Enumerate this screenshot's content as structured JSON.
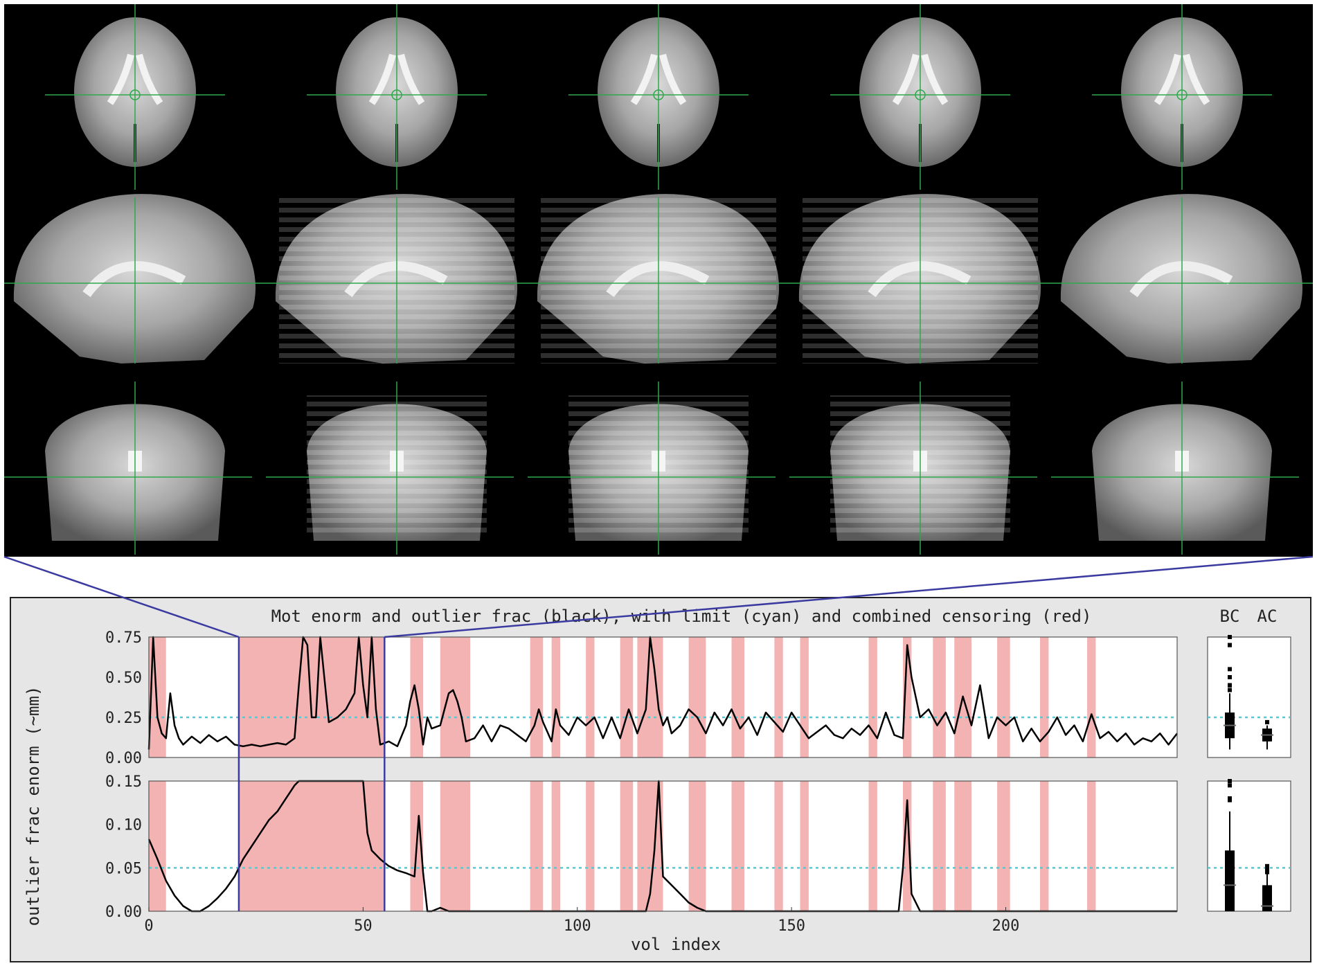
{
  "brain": {
    "columns": 5,
    "rows": [
      "axial",
      "sagittal",
      "coronal"
    ],
    "colors": {
      "background": "#000000",
      "crosshair": "#2ea84a"
    }
  },
  "plot": {
    "title": "Mot enorm and outlier frac (black), with limit (cyan) and combined censoring (red)",
    "ylabel": "outlier frac   enorm (~mm)",
    "xlabel": "vol index",
    "boxplot_labels": {
      "bc": "BC",
      "ac": "AC"
    },
    "colors": {
      "line": "#000000",
      "limit": "#5bc8d0",
      "censor": "#f4b3b3",
      "zoom": "#3a3aa0",
      "panel_bg": "#e6e6e6"
    }
  },
  "chart_data": [
    {
      "type": "line",
      "name": "enorm",
      "ylim": [
        0,
        0.75
      ],
      "yticks": [
        "0.75",
        "0.50",
        "0.25",
        "0.00"
      ],
      "xlim": [
        0,
        240
      ],
      "limit": 0.25,
      "x": [
        0,
        1,
        2,
        3,
        4,
        5,
        6,
        7,
        8,
        10,
        12,
        14,
        16,
        18,
        20,
        22,
        24,
        26,
        28,
        30,
        32,
        34,
        35,
        36,
        37,
        38,
        39,
        40,
        42,
        44,
        46,
        48,
        49,
        50,
        51,
        52,
        53,
        54,
        56,
        58,
        60,
        61,
        62,
        63,
        64,
        65,
        66,
        68,
        70,
        71,
        72,
        73,
        74,
        76,
        78,
        80,
        82,
        84,
        86,
        88,
        90,
        91,
        92,
        94,
        95,
        96,
        98,
        100,
        102,
        104,
        106,
        108,
        110,
        112,
        114,
        116,
        117,
        118,
        119,
        120,
        121,
        122,
        124,
        126,
        128,
        130,
        132,
        134,
        136,
        138,
        140,
        142,
        144,
        146,
        148,
        150,
        152,
        154,
        156,
        158,
        160,
        162,
        164,
        166,
        168,
        170,
        172,
        174,
        176,
        177,
        178,
        180,
        182,
        184,
        186,
        188,
        190,
        192,
        194,
        196,
        198,
        200,
        202,
        204,
        206,
        208,
        210,
        212,
        214,
        216,
        218,
        220,
        222,
        224,
        226,
        228,
        230,
        232,
        234,
        236,
        238,
        240
      ],
      "y": [
        0.05,
        0.75,
        0.25,
        0.15,
        0.12,
        0.4,
        0.2,
        0.12,
        0.08,
        0.13,
        0.09,
        0.14,
        0.1,
        0.13,
        0.08,
        0.07,
        0.08,
        0.07,
        0.08,
        0.09,
        0.08,
        0.12,
        0.45,
        0.8,
        0.7,
        0.25,
        0.25,
        0.8,
        0.22,
        0.25,
        0.3,
        0.4,
        0.8,
        0.45,
        0.25,
        0.8,
        0.3,
        0.08,
        0.1,
        0.07,
        0.2,
        0.35,
        0.45,
        0.3,
        0.08,
        0.25,
        0.18,
        0.2,
        0.4,
        0.42,
        0.35,
        0.25,
        0.1,
        0.12,
        0.2,
        0.1,
        0.2,
        0.18,
        0.14,
        0.1,
        0.2,
        0.3,
        0.22,
        0.1,
        0.3,
        0.2,
        0.14,
        0.25,
        0.2,
        0.25,
        0.12,
        0.25,
        0.12,
        0.3,
        0.15,
        0.3,
        0.8,
        0.55,
        0.3,
        0.2,
        0.25,
        0.15,
        0.2,
        0.3,
        0.25,
        0.15,
        0.28,
        0.2,
        0.3,
        0.18,
        0.25,
        0.14,
        0.28,
        0.22,
        0.16,
        0.28,
        0.2,
        0.12,
        0.16,
        0.2,
        0.14,
        0.12,
        0.18,
        0.14,
        0.2,
        0.12,
        0.28,
        0.14,
        0.12,
        0.7,
        0.5,
        0.25,
        0.3,
        0.2,
        0.28,
        0.15,
        0.38,
        0.2,
        0.45,
        0.12,
        0.25,
        0.2,
        0.25,
        0.1,
        0.18,
        0.1,
        0.16,
        0.25,
        0.14,
        0.2,
        0.1,
        0.27,
        0.12,
        0.16,
        0.1,
        0.15,
        0.08,
        0.12,
        0.1,
        0.15,
        0.08,
        0.15
      ]
    },
    {
      "type": "line",
      "name": "outlier frac",
      "ylim": [
        0,
        0.15
      ],
      "yticks": [
        "0.15",
        "0.10",
        "0.05",
        "0.00"
      ],
      "xlim": [
        0,
        240
      ],
      "xticks": [
        "0",
        "50",
        "100",
        "150",
        "200"
      ],
      "limit": 0.05,
      "x": [
        0,
        2,
        4,
        6,
        8,
        10,
        12,
        14,
        16,
        18,
        20,
        22,
        24,
        26,
        28,
        30,
        32,
        34,
        35,
        50,
        51,
        52,
        54,
        56,
        58,
        60,
        62,
        63,
        64,
        65,
        66,
        68,
        70,
        72,
        80,
        100,
        116,
        117,
        118,
        119,
        120,
        121,
        122,
        124,
        126,
        128,
        130,
        140,
        160,
        175,
        176,
        177,
        178,
        180,
        200,
        220,
        240
      ],
      "y": [
        0.083,
        0.06,
        0.035,
        0.018,
        0.006,
        0.0,
        0.0,
        0.006,
        0.015,
        0.026,
        0.04,
        0.06,
        0.075,
        0.09,
        0.105,
        0.115,
        0.13,
        0.145,
        0.15,
        0.15,
        0.09,
        0.07,
        0.06,
        0.052,
        0.047,
        0.044,
        0.04,
        0.11,
        0.045,
        0.0,
        0.0,
        0.004,
        0.0,
        0.0,
        0.0,
        0.0,
        0.0,
        0.02,
        0.07,
        0.15,
        0.04,
        0.035,
        0.03,
        0.02,
        0.01,
        0.004,
        0.0,
        0.0,
        0.0,
        0.0,
        0.05,
        0.128,
        0.02,
        0.0,
        0.0,
        0.0,
        0.0
      ]
    },
    {
      "type": "bar",
      "name": "combined censoring",
      "censor_intervals": [
        [
          0,
          4
        ],
        [
          21,
          55
        ],
        [
          61,
          64
        ],
        [
          68,
          75
        ],
        [
          89,
          92
        ],
        [
          94,
          96
        ],
        [
          102,
          104
        ],
        [
          110,
          113
        ],
        [
          114,
          120
        ],
        [
          126,
          130
        ],
        [
          136,
          139
        ],
        [
          146,
          148
        ],
        [
          152,
          154
        ],
        [
          168,
          170
        ],
        [
          176,
          178
        ],
        [
          183,
          186
        ],
        [
          188,
          192
        ],
        [
          198,
          201
        ],
        [
          208,
          210
        ],
        [
          219,
          221
        ]
      ]
    }
  ]
}
